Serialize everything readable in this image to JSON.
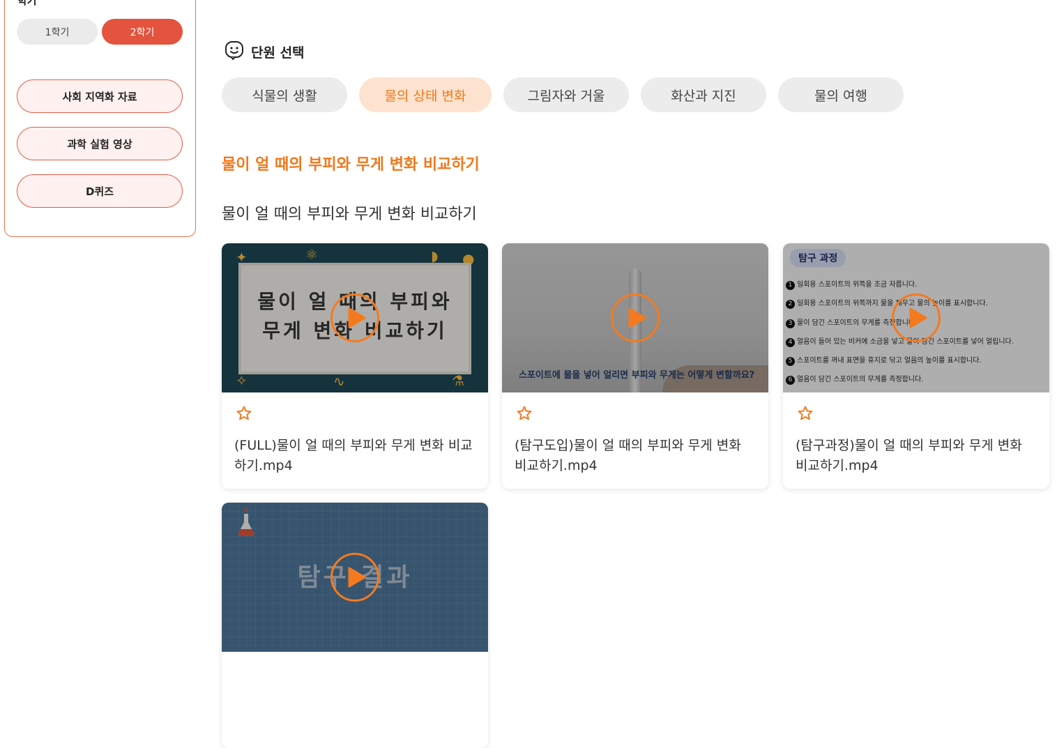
{
  "sidebar": {
    "semester_label": "학기",
    "semesters": [
      "1학기",
      "2학기"
    ],
    "menu": [
      "사회 지역화 자료",
      "과학 실험 영상",
      "D퀴즈"
    ]
  },
  "unit_select": {
    "title": "단원 선택",
    "units": [
      "식물의 생활",
      "물의 상태 변화",
      "그림자와 거울",
      "화산과 지진",
      "물의 여행"
    ],
    "active_index": 1
  },
  "lesson": {
    "title": "물이 얼 때의 부피와 무게 변화 비교하기",
    "subtitle": "물이 얼 때의 부피와 무게 변화 비교하기"
  },
  "colors": {
    "accent": "#f0781b",
    "semester_active": "#e3533d"
  },
  "videos": [
    {
      "title": "(FULL)물이 얼 때의 부피와 무게 변화 비교하기.mp4",
      "thumb_line1": "물이 얼 때의 부피와",
      "thumb_line2": "무게 변화 비교하기"
    },
    {
      "title": "(탐구도입)물이 얼 때의 부피와 무게 변화 비교하기.mp4",
      "thumb_caption": "스포이트에 물을 넣어 얼리면 부피와 무게는 어떻게 변할까요?"
    },
    {
      "title": "(탐구과정)물이 얼 때의 부피와 무게 변화 비교하기.mp4",
      "thumb_badge": "탐구 과정",
      "steps": [
        "일회용 스포이트의 위쪽을 조금 자릅니다.",
        "일회용 스포이트의 위쪽까지 물을 채우고 물의 높이를 표시합니다.",
        "물이 담긴 스포이트의 무게를 측정합니다.",
        "얼음이 들어 있는 비커에 소금을 넣고 물이 담긴 스포이트를 넣어 얼립니다.",
        "스포이트를 꺼내 표면을 휴지로 닦고 얼음의 높이를 표시합니다.",
        "얼음이 담긴 스포이트의 무게를 측정합니다."
      ],
      "step_numbers": [
        "1",
        "2",
        "3",
        "4",
        "5",
        "6"
      ]
    },
    {
      "title": "",
      "thumb_text": "탐구 결과"
    }
  ]
}
